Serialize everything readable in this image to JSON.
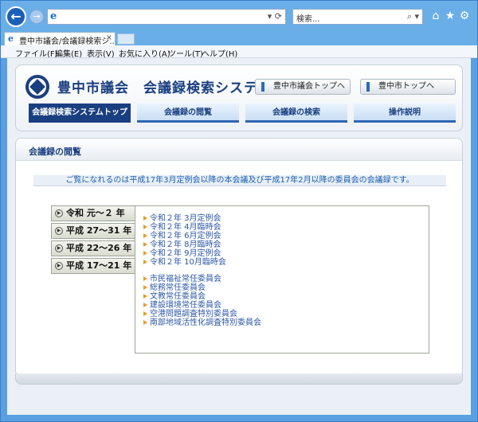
{
  "browser": {
    "address_url": "",
    "search_placeholder": "検索...",
    "tab_title": "豊中市議会/会議録検索シ...",
    "menu": [
      "ファイル(F)",
      "編集(E)",
      "表示(V)",
      "お気に入り(A)",
      "ツール(T)",
      "ヘルプ(H)"
    ],
    "icons": [
      "back-icon",
      "forward-icon",
      "home-icon",
      "star-icon",
      "gear-icon"
    ]
  },
  "header": {
    "title": "豊中市議会　会議録検索システム",
    "link_council": "豊中市議会トップへ",
    "link_city": "豊中市トップへ",
    "nav_tabs": [
      {
        "label": "会議録検索システムトップ"
      },
      {
        "label": "会議録の閲覧"
      },
      {
        "label": "会議録の検索"
      },
      {
        "label": "操作説明"
      }
    ]
  },
  "content": {
    "section_title": "会議録の閲覧",
    "notice": "ご覧になれるのは平成17年3月定例会以降の本会議及び平成17年2月以降の委員会の会議録です。",
    "years": [
      {
        "label": "令和 元～２ 年"
      },
      {
        "label": "平成 27～31 年"
      },
      {
        "label": "平成 22～26 年"
      },
      {
        "label": "平成 17～21 年"
      }
    ],
    "plenary_sessions": [
      "令和２年 3月定例会",
      "令和２年 4月臨時会",
      "令和２年 6月定例会",
      "令和２年 8月臨時会",
      "令和２年 9月定例会",
      "令和２年 10月臨時会"
    ],
    "committees": [
      "市民福祉常任委員会",
      "総務常任委員会",
      "文教常任委員会",
      "建設環境常任委員会",
      "空港問題調査特別委員会",
      "南部地域活性化調査特別委員会"
    ]
  },
  "colors": {
    "brand": "#1a3f80",
    "link": "#2d58a8",
    "bullet": "#f09a25"
  }
}
